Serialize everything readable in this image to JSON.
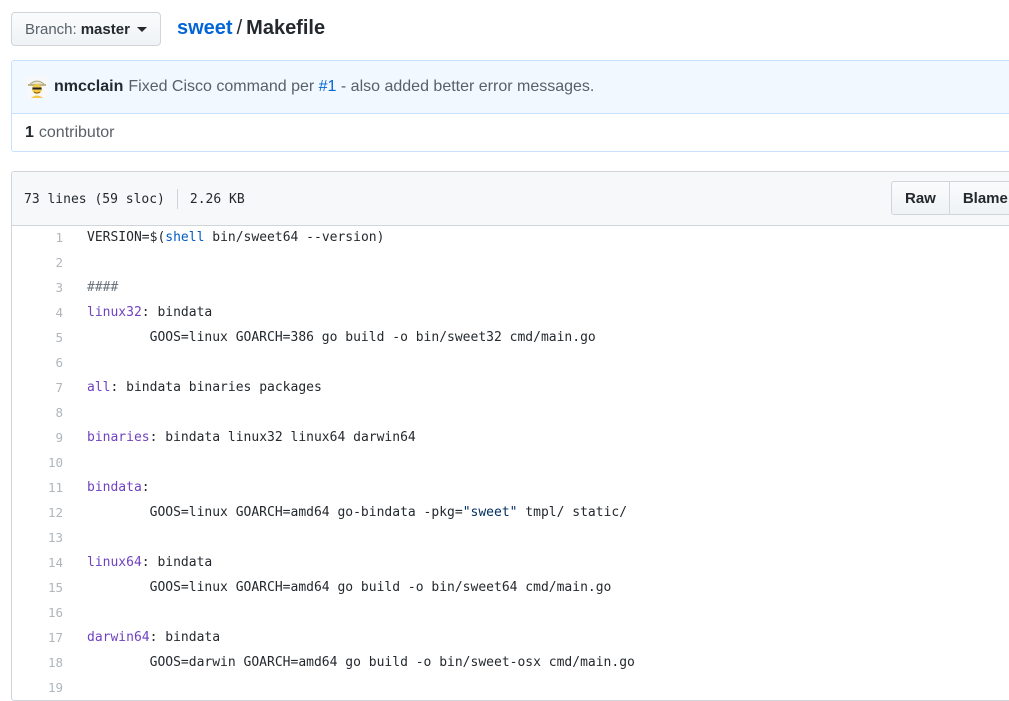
{
  "branch": {
    "prefix": "Branch:",
    "name": "master"
  },
  "breadcrumb": {
    "repo": "sweet",
    "separator": "/",
    "file": "Makefile"
  },
  "commit": {
    "author": "nmcclain",
    "message_before": "Fixed Cisco command per",
    "issue": "#1",
    "message_after": "- also added better error messages."
  },
  "contributors": {
    "count": "1",
    "label": "contributor"
  },
  "file_info": {
    "lines": "73 lines (59 sloc)",
    "size": "2.26 KB"
  },
  "actions": {
    "raw": "Raw",
    "blame": "Blame"
  },
  "colors": {
    "link": "#0366d6",
    "target": "#6f42c1",
    "keyword": "#005cc5",
    "string": "#032f62",
    "comment": "#6a737d"
  },
  "code_lines": [
    {
      "n": "1",
      "parts": [
        {
          "t": "VERSION=$(",
          "c": ""
        },
        {
          "t": "shell",
          "c": "kw"
        },
        {
          "t": " bin/sweet64 --version)",
          "c": ""
        }
      ]
    },
    {
      "n": "2",
      "parts": []
    },
    {
      "n": "3",
      "parts": [
        {
          "t": "####",
          "c": "comment"
        }
      ]
    },
    {
      "n": "4",
      "parts": [
        {
          "t": "linux32",
          "c": "target"
        },
        {
          "t": ": bindata",
          "c": ""
        }
      ]
    },
    {
      "n": "5",
      "parts": [
        {
          "t": "        GOOS=linux GOARCH=386 go build -o bin/sweet32 cmd/main.go",
          "c": ""
        }
      ]
    },
    {
      "n": "6",
      "parts": []
    },
    {
      "n": "7",
      "parts": [
        {
          "t": "all",
          "c": "target"
        },
        {
          "t": ": bindata binaries packages",
          "c": ""
        }
      ]
    },
    {
      "n": "8",
      "parts": []
    },
    {
      "n": "9",
      "parts": [
        {
          "t": "binaries",
          "c": "target"
        },
        {
          "t": ": bindata linux32 linux64 darwin64",
          "c": ""
        }
      ]
    },
    {
      "n": "10",
      "parts": []
    },
    {
      "n": "11",
      "parts": [
        {
          "t": "bindata",
          "c": "target"
        },
        {
          "t": ":",
          "c": ""
        }
      ]
    },
    {
      "n": "12",
      "parts": [
        {
          "t": "        GOOS=linux GOARCH=amd64 go-bindata -pkg=",
          "c": ""
        },
        {
          "t": "\"sweet\"",
          "c": "str"
        },
        {
          "t": " tmpl/ static/",
          "c": ""
        }
      ]
    },
    {
      "n": "13",
      "parts": []
    },
    {
      "n": "14",
      "parts": [
        {
          "t": "linux64",
          "c": "target"
        },
        {
          "t": ": bindata",
          "c": ""
        }
      ]
    },
    {
      "n": "15",
      "parts": [
        {
          "t": "        GOOS=linux GOARCH=amd64 go build -o bin/sweet64 cmd/main.go",
          "c": ""
        }
      ]
    },
    {
      "n": "16",
      "parts": []
    },
    {
      "n": "17",
      "parts": [
        {
          "t": "darwin64",
          "c": "target"
        },
        {
          "t": ": bindata",
          "c": ""
        }
      ]
    },
    {
      "n": "18",
      "parts": [
        {
          "t": "        GOOS=darwin GOARCH=amd64 go build -o bin/sweet-osx cmd/main.go",
          "c": ""
        }
      ]
    },
    {
      "n": "19",
      "parts": []
    }
  ]
}
